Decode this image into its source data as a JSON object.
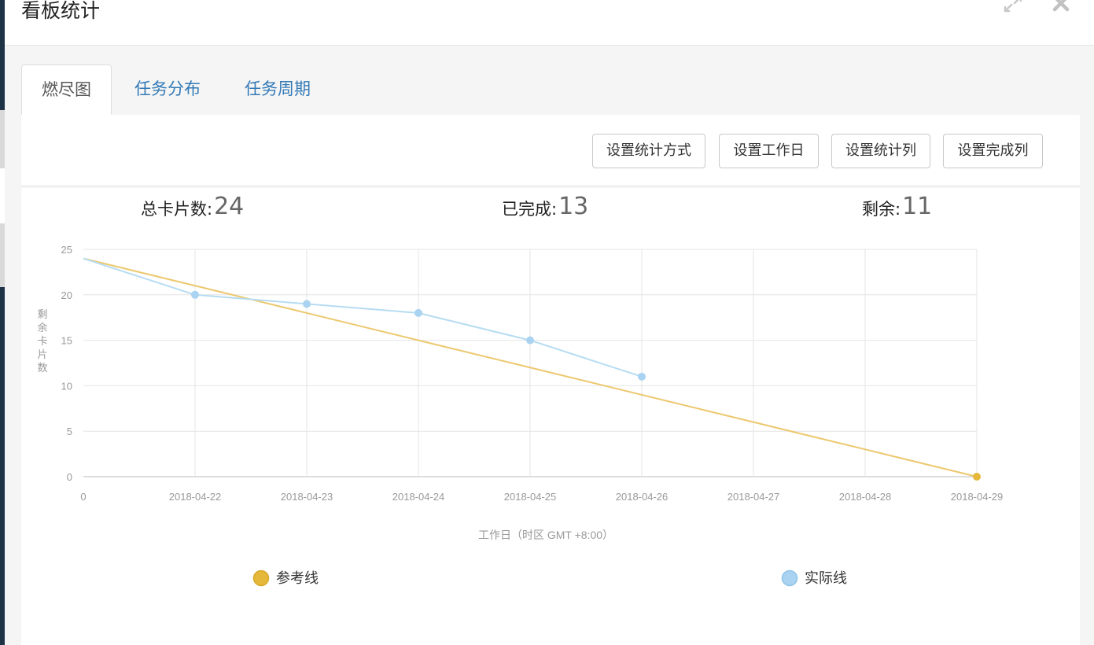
{
  "window": {
    "title": "看板统计",
    "icons": {
      "expand": "expand-icon",
      "close": "close-icon"
    }
  },
  "tabs": [
    {
      "label": "燃尽图",
      "active": true
    },
    {
      "label": "任务分布",
      "active": false
    },
    {
      "label": "任务周期",
      "active": false
    }
  ],
  "toolbar": {
    "set_method": "设置统计方式",
    "set_workday": "设置工作日",
    "set_stat_columns": "设置统计列",
    "set_done_columns": "设置完成列"
  },
  "stats": {
    "total_label": "总卡片数:",
    "total_value": "24",
    "done_label": "已完成:",
    "done_value": "13",
    "remaining_label": "剩余:",
    "remaining_value": "11"
  },
  "colors": {
    "reference": "#ecc86e",
    "actual": "#b6dcf2",
    "actual_dot": "#a9d3f0",
    "reference_dot": "#e5b73b",
    "grid": "#e4e4e4",
    "link": "#337ab7"
  },
  "chart_data": {
    "type": "line",
    "title": "",
    "xlabel": "工作日（时区 GMT +8:00）",
    "ylabel": "剩余卡片数",
    "x_categories": [
      "0",
      "2018-04-22",
      "2018-04-23",
      "2018-04-24",
      "2018-04-25",
      "2018-04-26",
      "2018-04-27",
      "2018-04-28",
      "2018-04-29"
    ],
    "y_ticks": [
      0,
      5,
      10,
      15,
      20,
      25
    ],
    "ylim": [
      0,
      25
    ],
    "grid": true,
    "legend_position": "bottom",
    "series": [
      {
        "name": "参考线",
        "values": [
          24,
          21,
          18,
          15,
          12,
          9,
          6,
          3,
          0
        ],
        "markers": [
          8
        ]
      },
      {
        "name": "实际线",
        "values": [
          24,
          20,
          19,
          18,
          15,
          11
        ],
        "markers": [
          1,
          2,
          3,
          4,
          5
        ]
      }
    ]
  }
}
